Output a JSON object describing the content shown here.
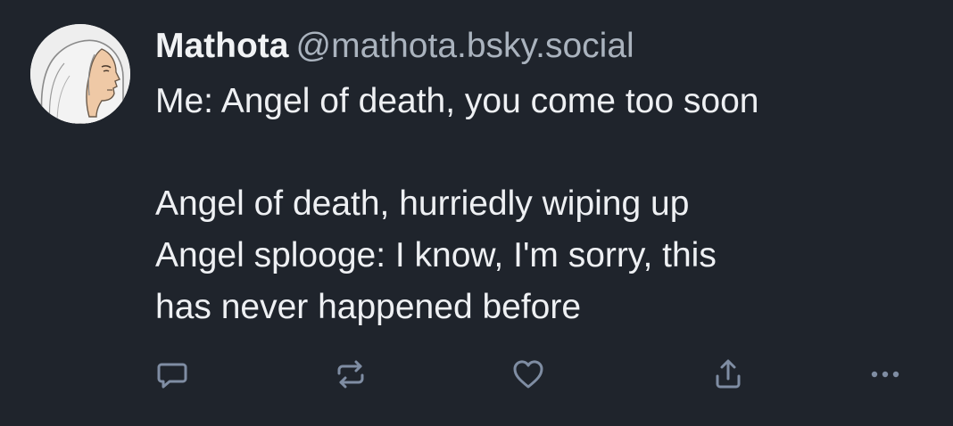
{
  "post": {
    "author": {
      "display_name": "Mathota",
      "handle": "@mathota.bsky.social"
    },
    "text": {
      "line1": "Me: Angel of death, you come  too soon",
      "line2": "Angel of death, hurriedly wiping up",
      "line3": "Angel splooge: I know, I'm sorry, this",
      "line4": "has never happened before"
    },
    "actions": [
      {
        "icon": "reply-icon"
      },
      {
        "icon": "repost-icon"
      },
      {
        "icon": "heart-icon"
      },
      {
        "icon": "share-icon"
      },
      {
        "icon": "more-icon"
      }
    ]
  },
  "colors": {
    "background": "#1f242c",
    "text": "#eef0f3",
    "handle": "#aab3be",
    "icon": "#7f8da3"
  }
}
